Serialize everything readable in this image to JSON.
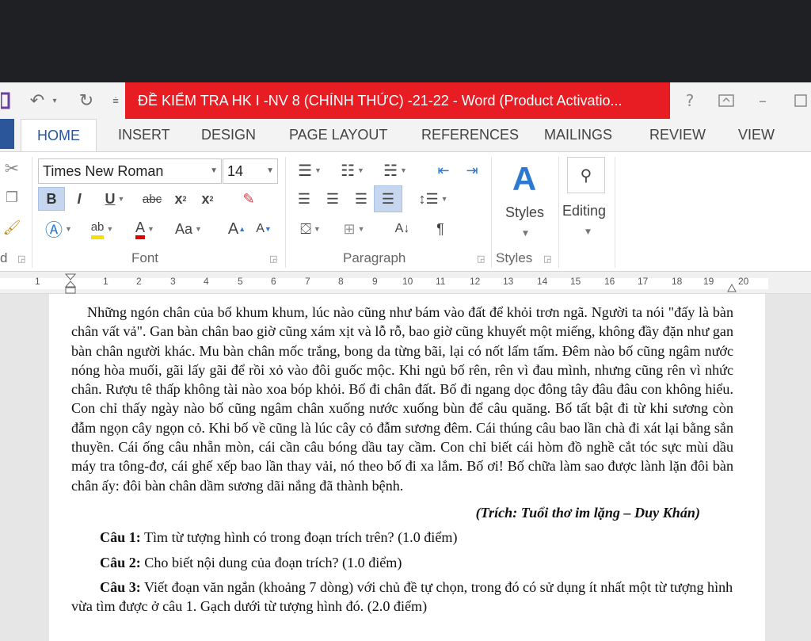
{
  "window": {
    "title": "ĐỀ KIỂM TRA HK I -NV 8  (CHÍNH THỨC) -21-22 -  Word (Product Activatio..."
  },
  "tabs": [
    {
      "label": "HOME",
      "active": true
    },
    {
      "label": "INSERT"
    },
    {
      "label": "DESIGN"
    },
    {
      "label": "PAGE LAYOUT"
    },
    {
      "label": "REFERENCES"
    },
    {
      "label": "MAILINGS"
    },
    {
      "label": "REVIEW"
    },
    {
      "label": "VIEW"
    }
  ],
  "ribbon": {
    "clipboard_label_fragment": "d",
    "font": {
      "name": "Times New Roman",
      "size": "14",
      "bold": "B",
      "italic": "I",
      "underline": "U",
      "strike": "abc",
      "subscript": "x",
      "superscript": "x",
      "change_case": "Aa",
      "grow": "A",
      "shrink": "A",
      "group_label": "Font"
    },
    "paragraph": {
      "group_label": "Paragraph",
      "pilcrow": "¶"
    },
    "styles": {
      "button_label": "Styles",
      "group_label": "Styles"
    },
    "editing": {
      "button_label": "Editing"
    }
  },
  "ruler": {
    "numbers": [
      "1",
      "1",
      "2",
      "3",
      "4",
      "5",
      "6",
      "7",
      "8",
      "9",
      "10",
      "11",
      "12",
      "13",
      "14",
      "15",
      "16",
      "17",
      "18",
      "19",
      "20"
    ]
  },
  "document": {
    "paragraph": "Những ngón chân của bố khum khum, lúc nào cũng như bám vào đất để khỏi trơn ngã. Người ta nói \"đấy là bàn chân vất vả\". Gan bàn chân bao giờ cũng xám xịt và lỗ rỗ, bao giờ cũng khuyết một miếng, không đầy đặn như gan bàn chân người khác. Mu bàn chân mốc trắng, bong da từng bãi, lại có nốt lấm tấm. Đêm nào bố cũng ngâm nước nóng hòa muối, gãi lấy gãi để rồi xỏ vào đôi guốc mộc. Khi ngủ bố rên, rên vì đau mình, nhưng cũng rên vì nhức chân. Rượu tê thấp không tài nào xoa bóp khỏi. Bố đi chân đất. Bố đi ngang dọc đông tây đâu đâu con không hiểu. Con chỉ thấy ngày nào bố cũng ngâm chân xuống nước xuống bùn để câu quăng. Bố tất bật đi từ khi sương còn đẫm ngọn cây ngọn cỏ. Khi bố về cũng là lúc cây cỏ đẫm sương đêm. Cái thúng câu bao lần chà đi xát lại bằng sắn thuyền. Cái ống câu nhẵn mòn, cái cần câu bóng dầu tay cầm. Con chỉ biết cái hòm đồ nghề cắt tóc sực mùi dầu máy tra tông-đơ, cái ghế xếp bao lần thay vải, nó theo bố đi xa lắm. Bố ơi! Bố chữa làm sao được lành lặn đôi bàn chân ấy: đôi bàn chân dầm sương dãi nắng đã thành bệnh.",
    "source": "(Trích: Tuổi thơ im lặng – Duy Khán)",
    "questions": [
      {
        "label": "Câu 1:",
        "text": " Tìm từ tượng hình có trong đoạn trích trên? (1.0 điểm)"
      },
      {
        "label": "Câu 2:",
        "text": " Cho biết nội dung của đoạn trích? (1.0 điểm)"
      },
      {
        "label": "Câu 3:",
        "text": " Viết đoạn văn ngắn (khoảng 7 dòng) với chủ đề tự chọn, trong đó có sử dụng ít nhất một từ tượng hình vừa tìm được ở câu 1. Gạch dưới từ tượng hình đó. (2.0 điểm)"
      }
    ]
  },
  "icons": [
    "save-icon",
    "undo-icon",
    "redo-icon",
    "customize-qat-icon",
    "help-icon",
    "ribbon-display-icon",
    "minimize-icon",
    "maximize-icon",
    "cut-icon",
    "copy-icon",
    "format-painter-icon"
  ],
  "colors": {
    "title_bar": "#e81c23",
    "accent": "#2b579a",
    "highlight": "#f5e100",
    "font_color": "#e00000"
  }
}
